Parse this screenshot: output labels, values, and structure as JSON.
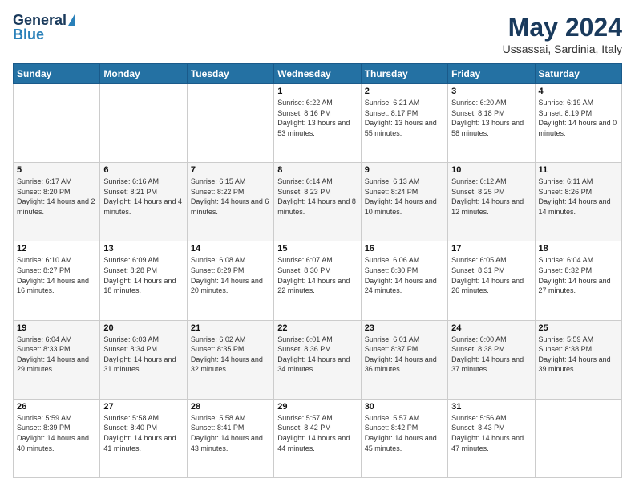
{
  "logo": {
    "line1": "General",
    "line2": "Blue"
  },
  "header": {
    "title": "May 2024",
    "location": "Ussassai, Sardinia, Italy"
  },
  "days_of_week": [
    "Sunday",
    "Monday",
    "Tuesday",
    "Wednesday",
    "Thursday",
    "Friday",
    "Saturday"
  ],
  "weeks": [
    [
      {
        "day": "",
        "sunrise": "",
        "sunset": "",
        "daylight": ""
      },
      {
        "day": "",
        "sunrise": "",
        "sunset": "",
        "daylight": ""
      },
      {
        "day": "",
        "sunrise": "",
        "sunset": "",
        "daylight": ""
      },
      {
        "day": "1",
        "sunrise": "Sunrise: 6:22 AM",
        "sunset": "Sunset: 8:16 PM",
        "daylight": "Daylight: 13 hours and 53 minutes."
      },
      {
        "day": "2",
        "sunrise": "Sunrise: 6:21 AM",
        "sunset": "Sunset: 8:17 PM",
        "daylight": "Daylight: 13 hours and 55 minutes."
      },
      {
        "day": "3",
        "sunrise": "Sunrise: 6:20 AM",
        "sunset": "Sunset: 8:18 PM",
        "daylight": "Daylight: 13 hours and 58 minutes."
      },
      {
        "day": "4",
        "sunrise": "Sunrise: 6:19 AM",
        "sunset": "Sunset: 8:19 PM",
        "daylight": "Daylight: 14 hours and 0 minutes."
      }
    ],
    [
      {
        "day": "5",
        "sunrise": "Sunrise: 6:17 AM",
        "sunset": "Sunset: 8:20 PM",
        "daylight": "Daylight: 14 hours and 2 minutes."
      },
      {
        "day": "6",
        "sunrise": "Sunrise: 6:16 AM",
        "sunset": "Sunset: 8:21 PM",
        "daylight": "Daylight: 14 hours and 4 minutes."
      },
      {
        "day": "7",
        "sunrise": "Sunrise: 6:15 AM",
        "sunset": "Sunset: 8:22 PM",
        "daylight": "Daylight: 14 hours and 6 minutes."
      },
      {
        "day": "8",
        "sunrise": "Sunrise: 6:14 AM",
        "sunset": "Sunset: 8:23 PM",
        "daylight": "Daylight: 14 hours and 8 minutes."
      },
      {
        "day": "9",
        "sunrise": "Sunrise: 6:13 AM",
        "sunset": "Sunset: 8:24 PM",
        "daylight": "Daylight: 14 hours and 10 minutes."
      },
      {
        "day": "10",
        "sunrise": "Sunrise: 6:12 AM",
        "sunset": "Sunset: 8:25 PM",
        "daylight": "Daylight: 14 hours and 12 minutes."
      },
      {
        "day": "11",
        "sunrise": "Sunrise: 6:11 AM",
        "sunset": "Sunset: 8:26 PM",
        "daylight": "Daylight: 14 hours and 14 minutes."
      }
    ],
    [
      {
        "day": "12",
        "sunrise": "Sunrise: 6:10 AM",
        "sunset": "Sunset: 8:27 PM",
        "daylight": "Daylight: 14 hours and 16 minutes."
      },
      {
        "day": "13",
        "sunrise": "Sunrise: 6:09 AM",
        "sunset": "Sunset: 8:28 PM",
        "daylight": "Daylight: 14 hours and 18 minutes."
      },
      {
        "day": "14",
        "sunrise": "Sunrise: 6:08 AM",
        "sunset": "Sunset: 8:29 PM",
        "daylight": "Daylight: 14 hours and 20 minutes."
      },
      {
        "day": "15",
        "sunrise": "Sunrise: 6:07 AM",
        "sunset": "Sunset: 8:30 PM",
        "daylight": "Daylight: 14 hours and 22 minutes."
      },
      {
        "day": "16",
        "sunrise": "Sunrise: 6:06 AM",
        "sunset": "Sunset: 8:30 PM",
        "daylight": "Daylight: 14 hours and 24 minutes."
      },
      {
        "day": "17",
        "sunrise": "Sunrise: 6:05 AM",
        "sunset": "Sunset: 8:31 PM",
        "daylight": "Daylight: 14 hours and 26 minutes."
      },
      {
        "day": "18",
        "sunrise": "Sunrise: 6:04 AM",
        "sunset": "Sunset: 8:32 PM",
        "daylight": "Daylight: 14 hours and 27 minutes."
      }
    ],
    [
      {
        "day": "19",
        "sunrise": "Sunrise: 6:04 AM",
        "sunset": "Sunset: 8:33 PM",
        "daylight": "Daylight: 14 hours and 29 minutes."
      },
      {
        "day": "20",
        "sunrise": "Sunrise: 6:03 AM",
        "sunset": "Sunset: 8:34 PM",
        "daylight": "Daylight: 14 hours and 31 minutes."
      },
      {
        "day": "21",
        "sunrise": "Sunrise: 6:02 AM",
        "sunset": "Sunset: 8:35 PM",
        "daylight": "Daylight: 14 hours and 32 minutes."
      },
      {
        "day": "22",
        "sunrise": "Sunrise: 6:01 AM",
        "sunset": "Sunset: 8:36 PM",
        "daylight": "Daylight: 14 hours and 34 minutes."
      },
      {
        "day": "23",
        "sunrise": "Sunrise: 6:01 AM",
        "sunset": "Sunset: 8:37 PM",
        "daylight": "Daylight: 14 hours and 36 minutes."
      },
      {
        "day": "24",
        "sunrise": "Sunrise: 6:00 AM",
        "sunset": "Sunset: 8:38 PM",
        "daylight": "Daylight: 14 hours and 37 minutes."
      },
      {
        "day": "25",
        "sunrise": "Sunrise: 5:59 AM",
        "sunset": "Sunset: 8:38 PM",
        "daylight": "Daylight: 14 hours and 39 minutes."
      }
    ],
    [
      {
        "day": "26",
        "sunrise": "Sunrise: 5:59 AM",
        "sunset": "Sunset: 8:39 PM",
        "daylight": "Daylight: 14 hours and 40 minutes."
      },
      {
        "day": "27",
        "sunrise": "Sunrise: 5:58 AM",
        "sunset": "Sunset: 8:40 PM",
        "daylight": "Daylight: 14 hours and 41 minutes."
      },
      {
        "day": "28",
        "sunrise": "Sunrise: 5:58 AM",
        "sunset": "Sunset: 8:41 PM",
        "daylight": "Daylight: 14 hours and 43 minutes."
      },
      {
        "day": "29",
        "sunrise": "Sunrise: 5:57 AM",
        "sunset": "Sunset: 8:42 PM",
        "daylight": "Daylight: 14 hours and 44 minutes."
      },
      {
        "day": "30",
        "sunrise": "Sunrise: 5:57 AM",
        "sunset": "Sunset: 8:42 PM",
        "daylight": "Daylight: 14 hours and 45 minutes."
      },
      {
        "day": "31",
        "sunrise": "Sunrise: 5:56 AM",
        "sunset": "Sunset: 8:43 PM",
        "daylight": "Daylight: 14 hours and 47 minutes."
      },
      {
        "day": "",
        "sunrise": "",
        "sunset": "",
        "daylight": ""
      }
    ]
  ]
}
